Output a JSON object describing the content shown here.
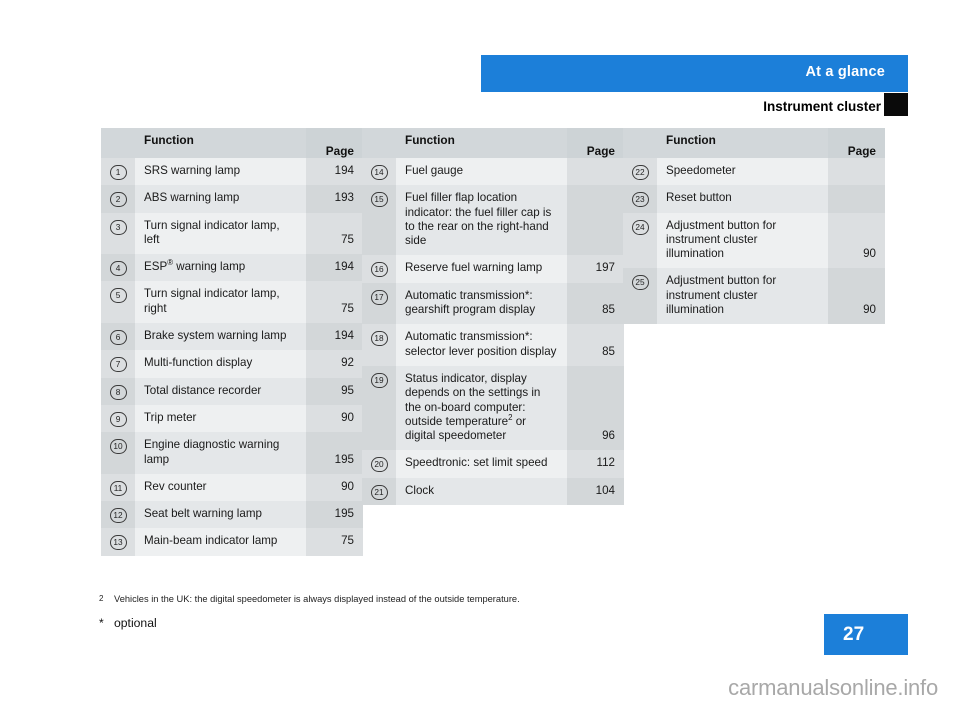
{
  "header": {
    "title": "At a glance",
    "subtitle": "Instrument cluster",
    "accent_color": "#1c7fd9",
    "tab_color": "#0a0a0a"
  },
  "columns": [
    {
      "headers": {
        "function": "Function",
        "page": "Page"
      },
      "rows": [
        {
          "num": "1",
          "function": "SRS warning lamp",
          "page": "194"
        },
        {
          "num": "2",
          "function": "ABS warning lamp",
          "page": "193"
        },
        {
          "num": "3",
          "function": "Turn signal indicator lamp, left",
          "page": "75"
        },
        {
          "num": "4",
          "function": "ESP® warning lamp",
          "page": "194"
        },
        {
          "num": "5",
          "function": "Turn signal indicator lamp, right",
          "page": "75"
        },
        {
          "num": "6",
          "function": "Brake system warning lamp",
          "page": "194"
        },
        {
          "num": "7",
          "function": "Multi-function display",
          "page": "92"
        },
        {
          "num": "8",
          "function": "Total distance recorder",
          "page": "95"
        },
        {
          "num": "9",
          "function": "Trip meter",
          "page": "90"
        },
        {
          "num": "10",
          "function": "Engine diagnostic warning lamp",
          "page": "195"
        },
        {
          "num": "11",
          "function": "Rev counter",
          "page": "90"
        },
        {
          "num": "12",
          "function": "Seat belt warning lamp",
          "page": "195"
        },
        {
          "num": "13",
          "function": "Main-beam indicator lamp",
          "page": "75"
        }
      ]
    },
    {
      "headers": {
        "function": "Function",
        "page": "Page"
      },
      "rows": [
        {
          "num": "14",
          "function": "Fuel gauge",
          "page": ""
        },
        {
          "num": "15",
          "function": "Fuel filler flap location indicator: the fuel filler cap is to the rear on the right-hand side",
          "page": ""
        },
        {
          "num": "16",
          "function": "Reserve fuel warning lamp",
          "page": "197"
        },
        {
          "num": "17",
          "function": "Automatic transmission*: gearshift program display",
          "page": "85"
        },
        {
          "num": "18",
          "function": "Automatic transmission*: selector lever position display",
          "page": "85"
        },
        {
          "num": "19",
          "function": "Status indicator, display depends on the settings in the on-board computer: outside temperature² or digital speedometer",
          "page": "96"
        },
        {
          "num": "20",
          "function": "Speedtronic: set limit speed",
          "page": "112"
        },
        {
          "num": "21",
          "function": "Clock",
          "page": "104"
        }
      ]
    },
    {
      "headers": {
        "function": "Function",
        "page": "Page"
      },
      "rows": [
        {
          "num": "22",
          "function": "Speedometer",
          "page": ""
        },
        {
          "num": "23",
          "function": "Reset button",
          "page": ""
        },
        {
          "num": "24",
          "function": "Adjustment button for instrument cluster illumination",
          "page": "90"
        },
        {
          "num": "25",
          "function": "Adjustment button for instrument cluster illumination",
          "page": "90"
        }
      ]
    }
  ],
  "footnotes": {
    "note2_marker": "2",
    "note2_text": "Vehicles in the UK: the digital speedometer is always displayed instead of the outside temperature.",
    "star_marker": "*",
    "star_text": "optional"
  },
  "page_number": "27",
  "watermark": "carmanualsonline.info"
}
